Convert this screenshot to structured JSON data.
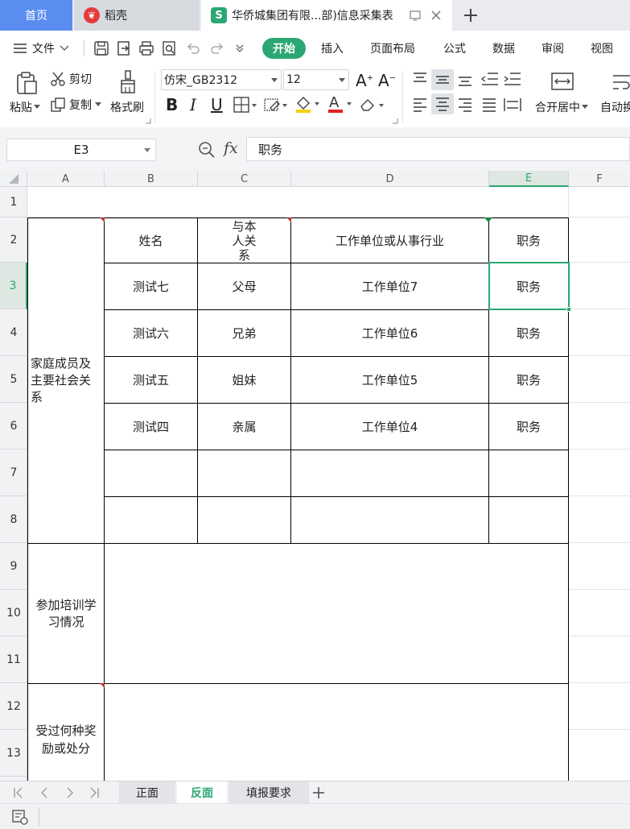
{
  "tabs": {
    "home": "首页",
    "docer": "稻壳",
    "doc": "华侨城集团有限...部)信息采集表"
  },
  "menu": {
    "file": "文件",
    "start": "开始",
    "insert": "插入",
    "layout": "页面布局",
    "formula": "公式",
    "data": "数据",
    "review": "审阅",
    "view": "视图"
  },
  "ribbon": {
    "paste": "粘贴",
    "cut": "剪切",
    "copy": "复制",
    "format_painter": "格式刷",
    "font_name": "仿宋_GB2312",
    "font_size": "12",
    "merge_center": "合开居中",
    "auto_wrap": "自动换"
  },
  "formula_bar": {
    "cell_ref": "E3",
    "fx": "fx",
    "value": "职务"
  },
  "columns": [
    "A",
    "B",
    "C",
    "D",
    "E",
    "F"
  ],
  "rows": [
    "1",
    "2",
    "3",
    "4",
    "5",
    "6",
    "7",
    "8",
    "9",
    "10",
    "11",
    "12",
    "13"
  ],
  "table": {
    "section_family": "家庭成员及主要社会关系",
    "section_training": "参加培训学习情况",
    "section_awards": "受过何种奖励或处分",
    "headers": {
      "name": "姓名",
      "relation": "与本人关系",
      "employer": "工作单位或从事行业",
      "position": "职务"
    },
    "members": [
      {
        "name": "测试七",
        "relation": "父母",
        "employer": "工作单位7",
        "position": "职务"
      },
      {
        "name": "测试六",
        "relation": "兄弟",
        "employer": "工作单位6",
        "position": "职务"
      },
      {
        "name": "测试五",
        "relation": "姐妹",
        "employer": "工作单位5",
        "position": "职务"
      },
      {
        "name": "测试四",
        "relation": "亲属",
        "employer": "工作单位4",
        "position": "职务"
      }
    ]
  },
  "sheets": {
    "front": "正面",
    "back": "反面",
    "requirements": "填报要求"
  },
  "colors": {
    "accent": "#2aa772",
    "home_tab": "#5b8df0"
  }
}
